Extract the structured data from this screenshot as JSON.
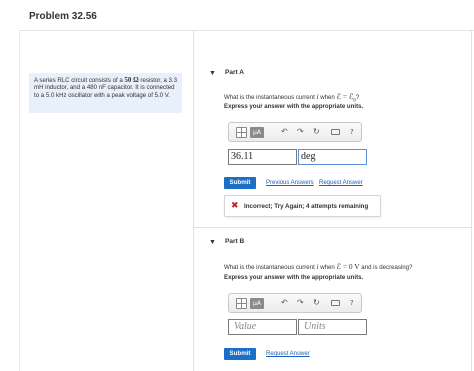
{
  "problem": {
    "title": "Problem 32.56",
    "statement_parts": {
      "pre": "A series RLC circuit consists of a ",
      "value": "50",
      "unit": "Ω",
      "post": " resistor, a 3.3 mH inductor, and a 480 nF capacitor. It is connected to a 5.0 kHz oscillator with a peak voltage of 5.0 V."
    }
  },
  "icons": {
    "part_caret": "triangle-down-icon",
    "template": "templates-grid-icon",
    "units": "mu-a-units-icon",
    "undo": "undo-arrow-icon",
    "redo": "redo-arrow-icon",
    "reset": "reset-icon",
    "keyboard": "keyboard-icon",
    "help": "help-question-icon",
    "incorrect": "x-mark-icon"
  },
  "colors": {
    "submit_bg": "#1c6fc7",
    "link": "#1c5fb8",
    "incorrect": "#cc1f1f",
    "statement_bg": "#e8f0fb"
  },
  "part_a": {
    "caret": "▼",
    "label": "Part A",
    "question_pre": "What is the instantaneous current ",
    "question_var": "i",
    "question_mid": " when ",
    "question_math": "ℰ = ℰ",
    "question_sub": "0",
    "question_post": "?",
    "instruction": "Express your answer with the appropriate units.",
    "toolbar": {
      "units_label": "μA",
      "undo": "↶",
      "redo": "↷",
      "reset": "↻",
      "help": "?"
    },
    "value_input": "36.11",
    "units_input": "deg",
    "submit_label": "Submit",
    "link_previous": "Previous Answers",
    "link_request": "Request Answer",
    "feedback_icon": "✖",
    "feedback_text": "Incorrect; Try Again; 4 attempts remaining"
  },
  "part_b": {
    "caret": "▼",
    "label": "Part B",
    "question_pre": "What is the instantaneous current ",
    "question_var": "i",
    "question_mid": " when ",
    "question_math": "ℰ = 0 V",
    "question_post": " and is decreasing?",
    "instruction": "Express your answer with the appropriate units.",
    "toolbar": {
      "units_label": "μA",
      "undo": "↶",
      "redo": "↷",
      "reset": "↻",
      "help": "?"
    },
    "value_placeholder": "Value",
    "units_placeholder": "Units",
    "submit_label": "Submit",
    "link_request": "Request Answer"
  }
}
